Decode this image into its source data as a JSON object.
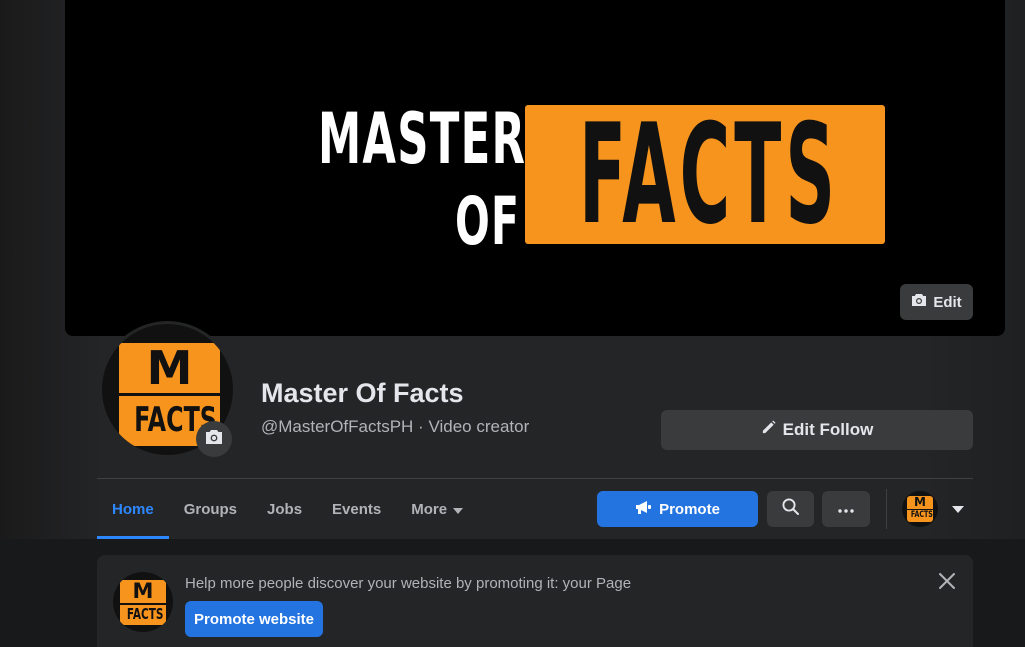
{
  "cover": {
    "logo_line1": "MASTER",
    "logo_line2": "OF",
    "logo_box_text": "FACTS",
    "edit_label": "Edit"
  },
  "logo": {
    "top": "M",
    "bottom": "FACTS"
  },
  "profile": {
    "name": "Master Of Facts",
    "subtitle": "@MasterOfFactsPH · Video creator",
    "edit_follow_label": "Edit Follow"
  },
  "tabs": [
    {
      "label": "Home",
      "active": true
    },
    {
      "label": "Groups"
    },
    {
      "label": "Jobs"
    },
    {
      "label": "Events"
    },
    {
      "label": "More"
    }
  ],
  "actions": {
    "promote_label": "Promote"
  },
  "banner": {
    "message": "Help more people discover your website by promoting it: your Page",
    "button_label": "Promote website"
  },
  "colors": {
    "accent": "#2374e1",
    "brand_orange": "#f7941d",
    "background": "#242526"
  },
  "icons": [
    "camera-icon",
    "pencil-icon",
    "megaphone-icon",
    "search-icon",
    "more-dots-icon",
    "caret-down-icon",
    "close-icon"
  ]
}
